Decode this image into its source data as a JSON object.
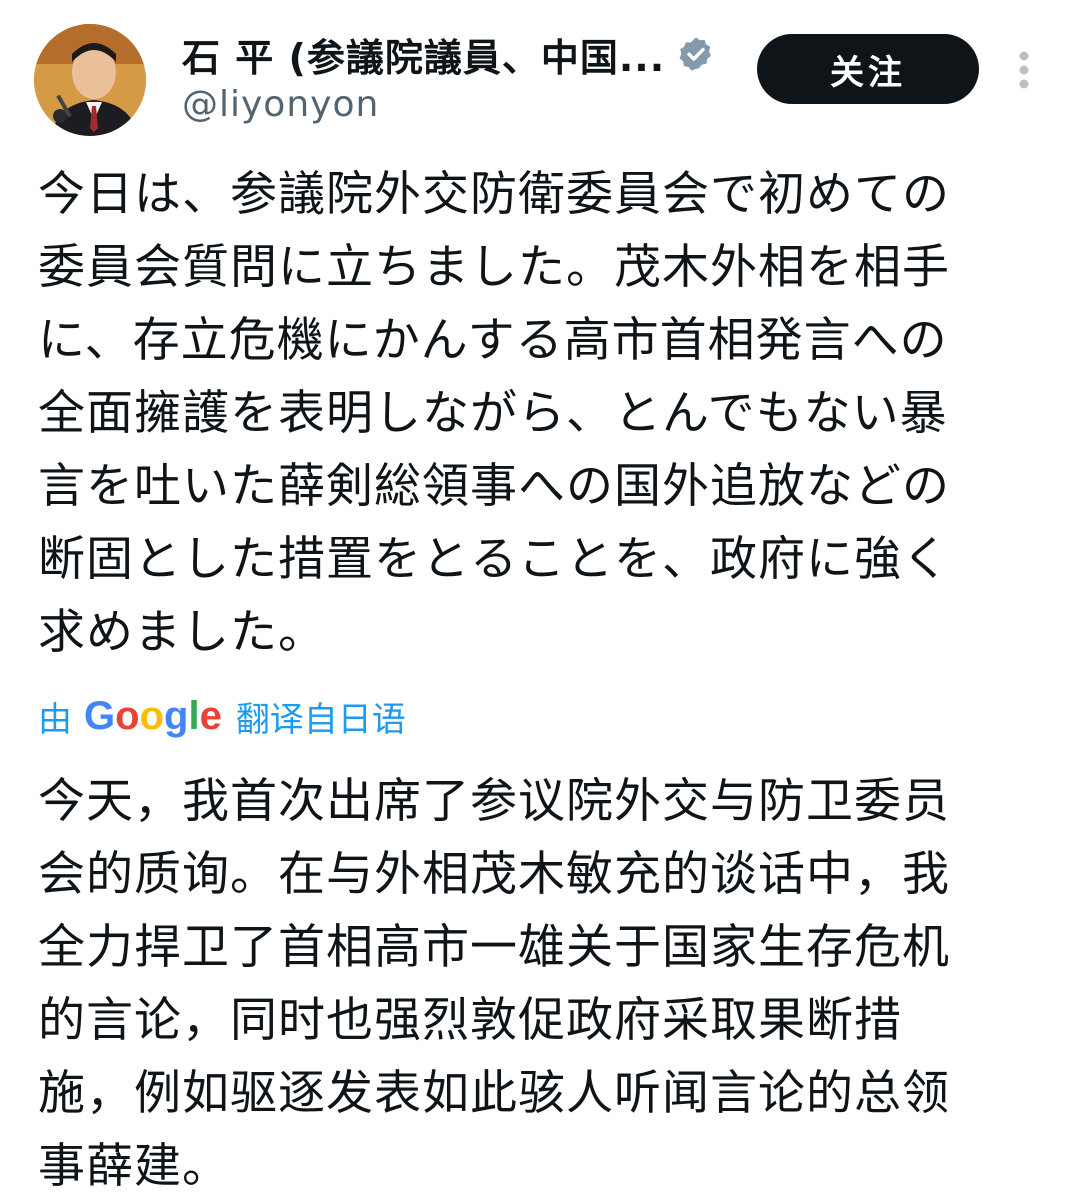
{
  "author": {
    "display_name": "石 平 (参議院議員、中国...",
    "handle": "@liyonyon",
    "avatar_icon": "avatar-photo-icon",
    "verified_icon": "verified-badge-icon",
    "verified_color": "#829aab"
  },
  "actions": {
    "follow_label": "关注",
    "more_icon": "more-vertical-icon"
  },
  "tweet": {
    "original_lines": [
      "今日は、参議院外交防衛委員会で初めての",
      "委員会質問に立ちました。茂木外相を相手",
      "に、存立危機にかんする高市首相発言への",
      "全面擁護を表明しながら、とんでもない暴",
      "言を吐いた薛剣総領事への国外追放などの",
      "断固とした措置をとることを、政府に強く",
      "求めました。"
    ],
    "translated_by": {
      "prefix": "由",
      "google_logo": "Google",
      "suffix": "翻译自日语"
    },
    "translation_lines": [
      "今天，我首次出席了参议院外交与防卫委员",
      "会的质询。在与外相茂木敏充的谈话中，我",
      "全力捍卫了首相高市一雄关于国家生存危机",
      "的言论，同时也强烈敦促政府采取果断措",
      "施，例如驱逐发表如此骇人听闻言论的总领",
      "事薛建。"
    ]
  },
  "colors": {
    "accent_link": "#1d9bf0",
    "follow_button_bg": "#0f1419",
    "text_primary": "#0f1419",
    "text_secondary": "#536471"
  }
}
